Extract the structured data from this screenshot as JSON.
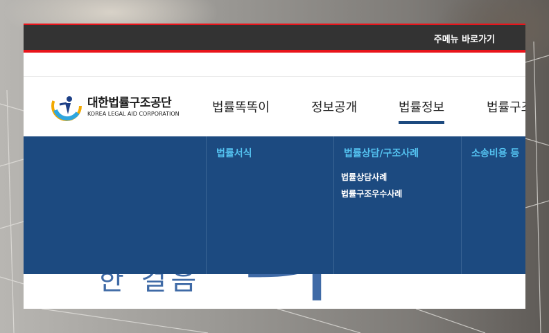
{
  "topbar": {
    "skip_link": "주메뉴 바로가기"
  },
  "logo": {
    "name_ko": "대한법률구조공단",
    "name_en": "KOREA LEGAL AID CORPORATION"
  },
  "nav": {
    "items": [
      {
        "label": "법률똑똑이",
        "active": false
      },
      {
        "label": "정보공개",
        "active": false
      },
      {
        "label": "법률정보",
        "active": true
      },
      {
        "label": "법률구조",
        "active": false
      }
    ]
  },
  "dropdown": {
    "columns": [
      {
        "heading": "법률서식",
        "links": []
      },
      {
        "heading": "법률상담/구조사례",
        "links": [
          "법률상담사례",
          "법률구조우수사례"
        ]
      },
      {
        "heading": "소송비용 등",
        "links": []
      }
    ]
  },
  "hero": {
    "line": "한 걸음",
    "big": "더"
  },
  "colors": {
    "topbar": "#333333",
    "accent_red": "#e8141b",
    "dropdown_bg": "#1c4a80",
    "heading": "#54c2f0",
    "nav_active": "#1d4a7f"
  }
}
